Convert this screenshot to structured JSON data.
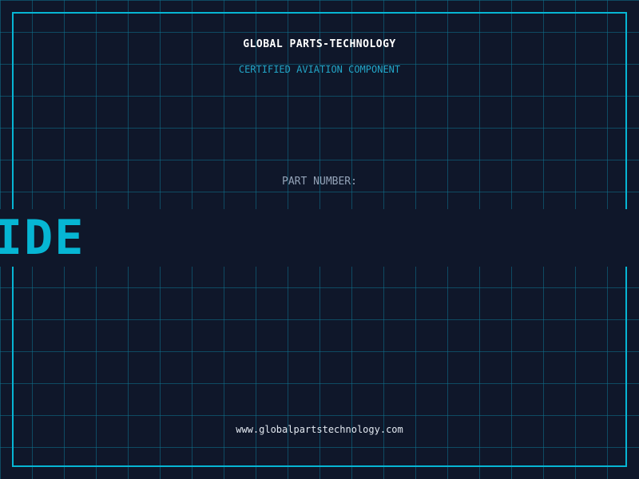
{
  "header": {
    "company_name": "GLOBAL PARTS-TECHNOLOGY",
    "subtitle": "CERTIFIED AVIATION COMPONENT"
  },
  "part": {
    "label": "PART NUMBER:",
    "number": "IDE"
  },
  "footer": {
    "website": "www.globalpartstechnology.com"
  },
  "colors": {
    "background": "#0f172a",
    "accent": "#06b6d4",
    "grid": "#0e7490",
    "label": "#94a3b8"
  }
}
